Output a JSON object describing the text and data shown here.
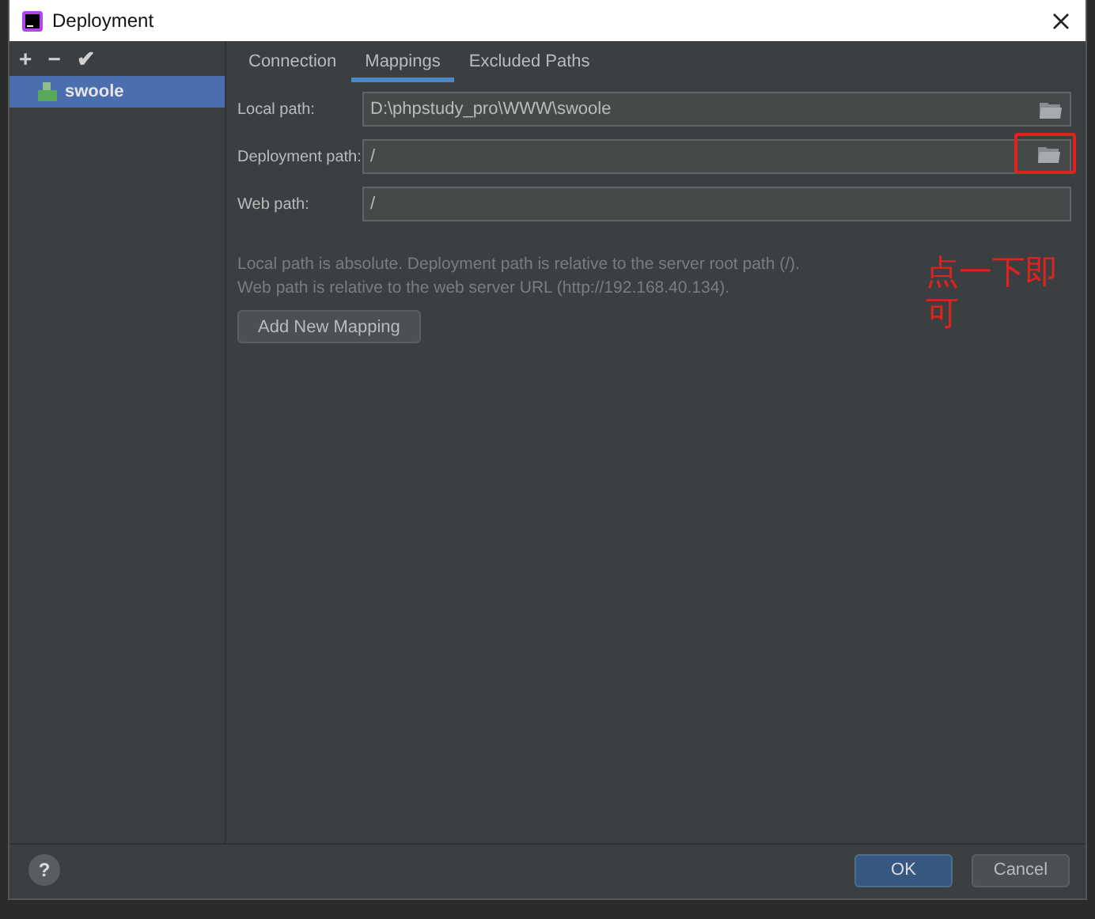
{
  "window": {
    "title": "Deployment"
  },
  "toolbar": [
    "+",
    "−",
    "✔"
  ],
  "servers": [
    {
      "name": "swoole",
      "selected": true
    }
  ],
  "tabs": [
    {
      "label": "Connection",
      "selected": false
    },
    {
      "label": "Mappings",
      "selected": true
    },
    {
      "label": "Excluded Paths",
      "selected": false
    }
  ],
  "fields": [
    {
      "label": "Local path:",
      "value": "D:\\phpstudy_pro\\WWW\\swoole",
      "browse": true,
      "highlighted": false
    },
    {
      "label": "Deployment path:",
      "value": "/",
      "browse": true,
      "highlighted": true
    },
    {
      "label": "Web path:",
      "value": "/",
      "browse": false,
      "highlighted": false
    }
  ],
  "hints": [
    "Local path is absolute. Deployment path is relative to the server root path (/).",
    "Web path is relative to the web server URL (http://192.168.40.134)."
  ],
  "add_button": "Add New Mapping",
  "annotation": "点一下即可",
  "help_button": "?",
  "buttons": [
    {
      "label": "OK",
      "kind": "primary"
    },
    {
      "label": "Cancel",
      "kind": "secondary"
    }
  ]
}
